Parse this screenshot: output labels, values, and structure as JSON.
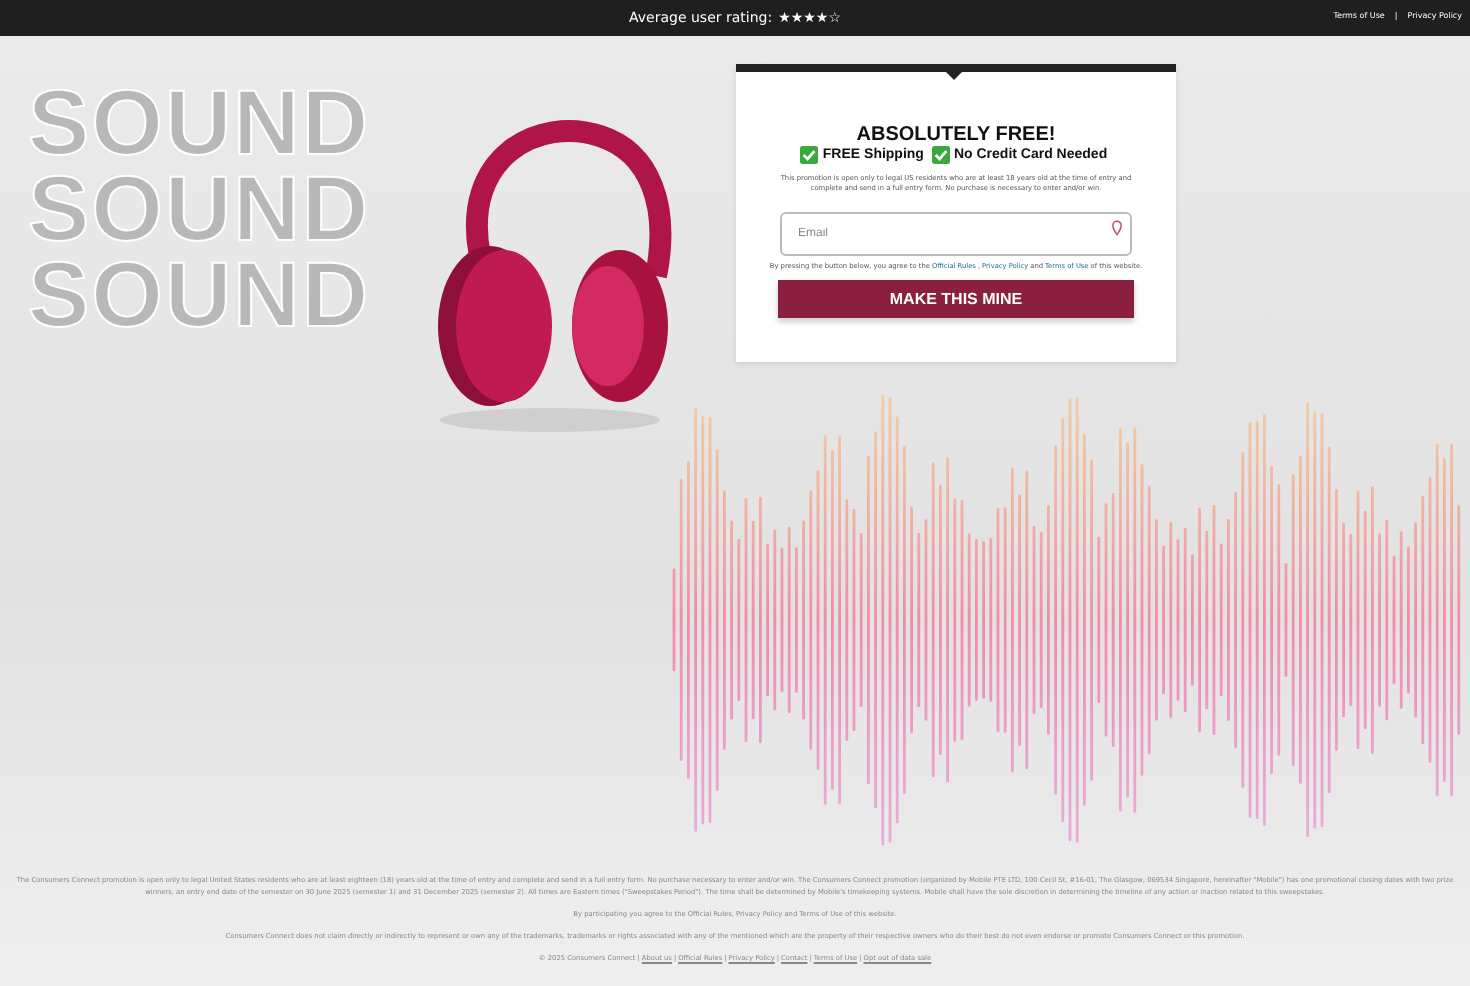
{
  "top_bar": {
    "rating_label": "Average user rating:",
    "stars": 4,
    "links": [
      "Terms of Use",
      "|",
      "Privacy Policy"
    ]
  },
  "hero": {
    "background_words": [
      "SOUND",
      "SOUND",
      "SOUND"
    ]
  },
  "form": {
    "title": "ABSOLUTELY FREE!",
    "badges": [
      "FREE Shipping",
      "No Credit Card Needed"
    ],
    "notice": "This promotion is open only to legal US residents who are at least 18 years old at the time of entry and complete and send in a full entry form. No purchase is necessary to enter and/or win.",
    "email": {
      "placeholder": "Email"
    },
    "agreement": {
      "before": "By pressing the button below, you agree to the",
      "links": [
        "Official Rules",
        ",",
        "Privacy Policy",
        "and",
        "Terms of Use"
      ],
      "after": "of this website."
    },
    "submit": "MAKE THIS MINE"
  },
  "footer": {
    "paragraphs": [
      "The Consumers Connect promotion is open only to legal United States residents who are at least eighteen (18) years old at the time of entry and complete and send in a full entry form. No purchase necessary to enter and/or win. The Consumers Connect promotion (organized by Mobile PTE LTD, 100 Cecil St, #16-01, The Glasgow, 069534 Singapore, hereinafter \"Mobile\") has one promotional closing dates with two prize winners, an entry end date of the semester on 30 June 2025 (semester 1) and 31 December 2025 (semester 2). All times are Eastern times (\"Sweepstakes Period\"). The time shall be determined by Mobile's timekeeping systems. Mobile shall have the sole discretion in determining the timeline of any action or inaction related to this sweepstakes.",
      "By participating you agree to the Official Rules, Privacy Policy and Terms of Use of this website.",
      "Consumers Connect does not claim directly or indirectly to represent or own any of the trademarks, trademarks or rights associated with any of the mentioned which are the property of their respective owners who do their best do not even endorse or promote Consumers Connect or this promotion."
    ],
    "copyright": "© 2025 Consumers Connect",
    "links": [
      "|",
      "About us",
      "|",
      "Official Rules",
      "|",
      "Privacy Policy",
      "|",
      "Contact",
      "|",
      "Terms of Use",
      "|",
      "Opt out of data sale"
    ]
  }
}
